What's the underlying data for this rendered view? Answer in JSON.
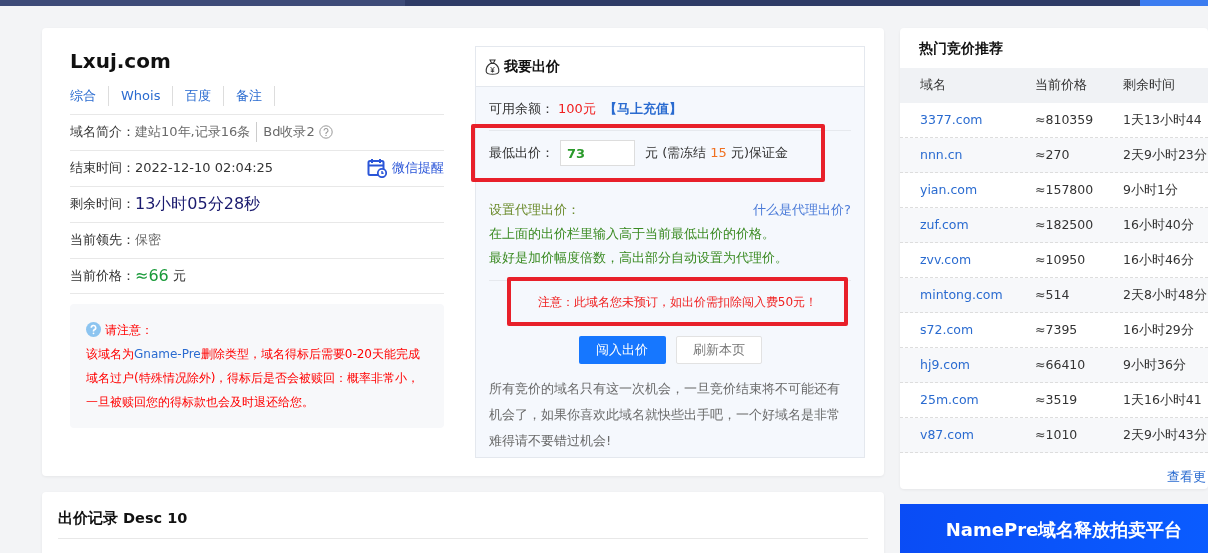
{
  "domain": {
    "name": "Lxuj.com",
    "links": [
      "综合",
      "Whois",
      "百度",
      "备注"
    ],
    "intro": {
      "label": "域名简介：",
      "value": "建站10年,记录16条",
      "extra": "Bd收录2"
    },
    "end_time": {
      "label": "结束时间：",
      "value": "2022-12-10 02:04:25",
      "reminder": "微信提醒"
    },
    "remaining": {
      "label": "剩余时间：",
      "value": "13小时05分28秒"
    },
    "leader": {
      "label": "当前领先：",
      "value": "保密"
    },
    "price": {
      "label": "当前价格：",
      "value": "≈66",
      "unit": "元"
    },
    "notice": {
      "title": "请注意：",
      "text_before": "该域名为",
      "highlight": "Gname-Pre",
      "text_after": "删除类型，域名得标后需要0-20天能完成域名过户(特殊情况除外)，得标后是否会被赎回：概率非常小，一旦被赎回您的得标款也会及时退还给您。"
    }
  },
  "bid": {
    "title": "我要出价",
    "balance": {
      "label": "可用余额：",
      "value": "100元",
      "recharge": "【马上充值】"
    },
    "min_bid": {
      "label": "最低出价：",
      "value": "73",
      "unit_before": "元 (需冻结",
      "freeze": "15",
      "unit_after": "元)保证金"
    },
    "proxy": {
      "label": "设置代理出价：",
      "help": "什么是代理出价?",
      "lines": [
        "在上面的出价栏里输入高于当前最低出价的价格。",
        "最好是加价幅度倍数，高出部分自动设置为代理价。"
      ]
    },
    "warning": "注意：此域名您未预订，如出价需扣除闯入费50元！",
    "buttons": [
      {
        "label": "闯入出价",
        "kind": "primary"
      },
      {
        "label": "刷新本页",
        "kind": "secondary"
      }
    ],
    "footer": "所有竞价的域名只有这一次机会，一旦竞价结束将不可能还有机会了，如果你喜欢此域名就快些出手吧，一个好域名是非常难得请不要错过机会!"
  },
  "records": {
    "title": "出价记录 Desc 10"
  },
  "hot": {
    "title": "热门竞价推荐",
    "columns": [
      "域名",
      "当前价格",
      "剩余时间"
    ],
    "rows": [
      {
        "domain": "3377.com",
        "price": "≈810359",
        "time": "1天13小时44"
      },
      {
        "domain": "nnn.cn",
        "price": "≈270",
        "time": "2天9小时23分"
      },
      {
        "domain": "yian.com",
        "price": "≈157800",
        "time": "9小时1分"
      },
      {
        "domain": "zuf.com",
        "price": "≈182500",
        "time": "16小时40分"
      },
      {
        "domain": "zvv.com",
        "price": "≈10950",
        "time": "16小时46分"
      },
      {
        "domain": "mintong.com",
        "price": "≈514",
        "time": "2天8小时48分"
      },
      {
        "domain": "s72.com",
        "price": "≈7395",
        "time": "16小时29分"
      },
      {
        "domain": "hj9.com",
        "price": "≈66410",
        "time": "9小时36分"
      },
      {
        "domain": "25m.com",
        "price": "≈3519",
        "time": "1天16小时41"
      },
      {
        "domain": "v87.com",
        "price": "≈1010",
        "time": "2天9小时43分"
      }
    ],
    "more": "查看更"
  },
  "banner": {
    "title": "NamePre域名释放拍卖平台"
  }
}
